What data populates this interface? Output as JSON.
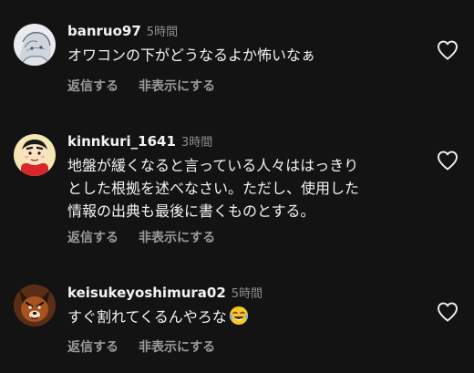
{
  "comments": [
    {
      "username": "banruo97",
      "time": "5時間",
      "text": "オワコンの下がどうなるよか怖いなぁ",
      "reply_label": "返信する",
      "hide_label": "非表示にする",
      "avatar_icon": "anime-drawing-avatar",
      "like_icon": "heart-outline-icon"
    },
    {
      "username": "kinnkuri_1641",
      "time": "3時間",
      "text": "地盤が緩くなると言っている人々ははっきり\nとした根拠を述べなさい。ただし、使用した\n情報の出典も最後に書くものとする。",
      "reply_label": "返信する",
      "hide_label": "非表示にする",
      "avatar_icon": "cartoon-boy-avatar",
      "like_icon": "heart-outline-icon"
    },
    {
      "username": "keisukeyoshimura02",
      "time": "5時間",
      "text": "すぐ割れてくるんやろな",
      "emoji": "tears-of-joy-emoji",
      "reply_label": "返信する",
      "hide_label": "非表示にする",
      "avatar_icon": "dog-mask-avatar",
      "like_icon": "heart-outline-icon"
    }
  ],
  "colors": {
    "background": "#131313",
    "text": "#f4f4f4",
    "muted": "#8e8e8e",
    "action": "#9a9a9a"
  }
}
